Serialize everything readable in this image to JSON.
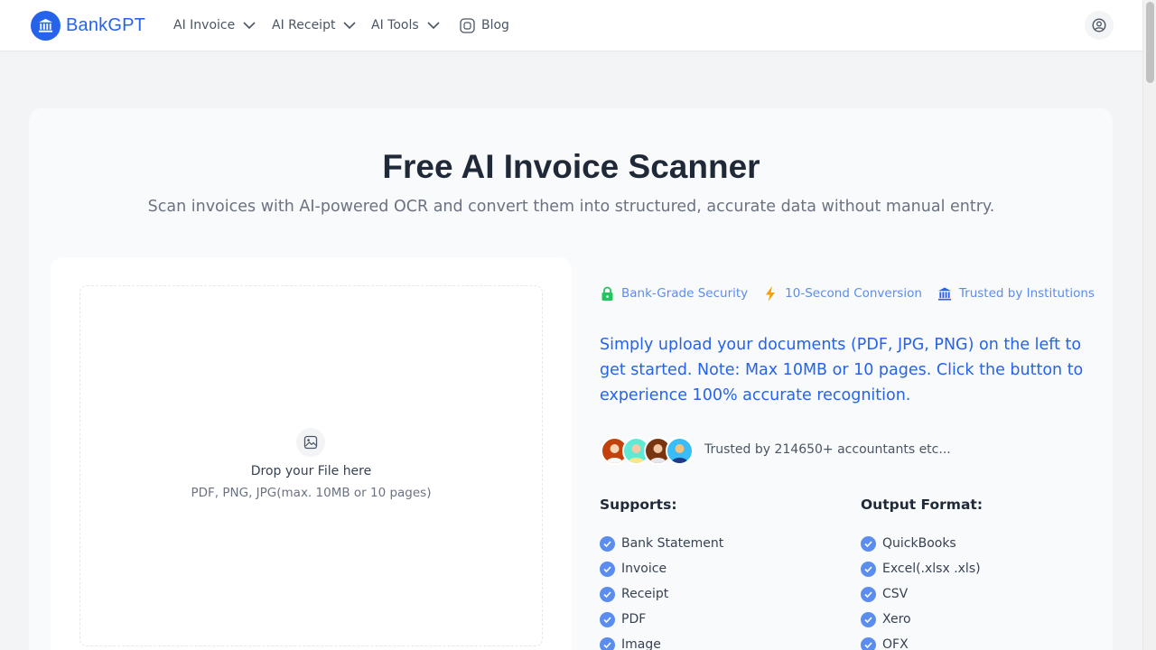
{
  "brand": {
    "name": "BankGPT",
    "color": "#2563eb"
  },
  "nav": {
    "items": [
      {
        "label": "AI Invoice",
        "has_dropdown": true
      },
      {
        "label": "AI Receipt",
        "has_dropdown": true
      },
      {
        "label": "AI Tools",
        "has_dropdown": true
      },
      {
        "label": "Blog",
        "has_dropdown": false
      }
    ],
    "user_icon": "user-circle-icon"
  },
  "hero": {
    "title": "Free AI Invoice Scanner",
    "subtitle": "Scan invoices with AI-powered OCR and convert them into structured, accurate data without manual entry."
  },
  "upload": {
    "icon": "image-icon",
    "title": "Drop your File here",
    "hint": "PDF, PNG, JPG(max. 10MB or 10 pages)"
  },
  "badges": [
    {
      "label": "Bank-Grade Security",
      "icon": "lock-icon",
      "color": "#22c55e"
    },
    {
      "label": "10-Second Conversion",
      "icon": "lightning-icon",
      "color": "#f59e0b"
    },
    {
      "label": "Trusted by Institutions",
      "icon": "bank-icon",
      "color": "#2563eb"
    }
  ],
  "description": "Simply upload your documents (PDF, JPG, PNG) on the left to get started. Note: Max 10MB or 10 pages. Click the button to experience 100% accurate recognition.",
  "trusted_text": "Trusted by 214650+ accountants etc...",
  "supports": {
    "heading": "Supports:",
    "items": [
      "Bank Statement",
      "Invoice",
      "Receipt",
      "PDF",
      "Image"
    ]
  },
  "output": {
    "heading": "Output Format:",
    "items": [
      "QuickBooks",
      "Excel(.xlsx .xls)",
      "CSV",
      "Xero",
      "OFX"
    ]
  }
}
